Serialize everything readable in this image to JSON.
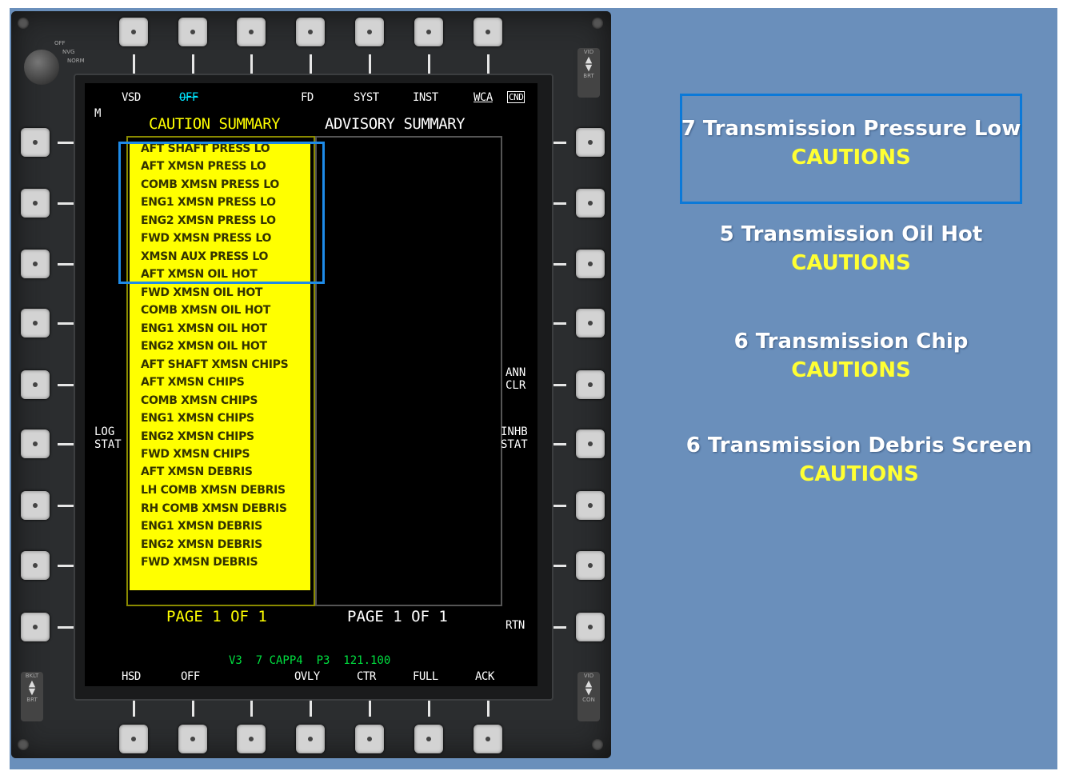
{
  "mfd": {
    "knob_labels": [
      "OFF",
      "NVG",
      "NORM"
    ],
    "rocker_top_right": [
      "VID",
      "BRT"
    ],
    "rocker_bottom_left": [
      "BKLT",
      "BRT"
    ],
    "rocker_bottom_right": [
      "VID",
      "CON"
    ],
    "top_labels": [
      "VSD",
      "OFF",
      "FD",
      "SYST",
      "INST",
      "WCA",
      "CND"
    ],
    "bottom_labels": [
      "HSD",
      "OFF",
      "OVLY",
      "CTR",
      "FULL",
      "ACK"
    ],
    "m_marker": "M",
    "left_label": [
      "LOG",
      "STAT"
    ],
    "right_labels": {
      "ann_clr": [
        "ANN",
        "CLR"
      ],
      "inhb_stat": [
        "INHB",
        "STAT"
      ],
      "rtn": "RTN"
    },
    "caution_title": "CAUTION SUMMARY",
    "advisory_title": "ADVISORY SUMMARY",
    "cautions": [
      "AFT SHAFT PRESS LO",
      "AFT XMSN PRESS LO",
      "COMB XMSN PRESS LO",
      "ENG1 XMSN PRESS LO",
      "ENG2 XMSN PRESS LO",
      "FWD XMSN PRESS LO",
      "XMSN AUX PRESS LO",
      "AFT XMSN OIL HOT",
      "FWD XMSN OIL HOT",
      "COMB XMSN OIL HOT",
      "ENG1 XMSN OIL HOT",
      "ENG2 XMSN OIL HOT",
      "AFT SHAFT XMSN CHIPS",
      "AFT XMSN CHIPS",
      "COMB XMSN CHIPS",
      "ENG1 XMSN CHIPS",
      "ENG2 XMSN CHIPS",
      "FWD XMSN CHIPS",
      "AFT XMSN DEBRIS",
      "LH COMB XMSN DEBRIS",
      "RH COMB XMSN DEBRIS",
      "ENG1 XMSN DEBRIS",
      "ENG2 XMSN DEBRIS",
      "FWD XMSN DEBRIS"
    ],
    "caution_page": "PAGE 1 OF 1",
    "advisory_page": "PAGE 1 OF 1",
    "status_line": "V3  7 CAPP4  P3  121.100"
  },
  "side_panel": [
    {
      "title": "7 Transmission Pressure Low",
      "subtitle": "CAUTIONS"
    },
    {
      "title": "5 Transmission Oil Hot",
      "subtitle": "CAUTIONS"
    },
    {
      "title": "6 Transmission Chip",
      "subtitle": "CAUTIONS"
    },
    {
      "title": "6 Transmission Debris Screen",
      "subtitle": "CAUTIONS"
    }
  ],
  "colors": {
    "caution_yellow": "#ffff00",
    "highlight_blue": "#1e8be8",
    "panel_blue": "#6a8fbb",
    "status_green": "#00e040"
  }
}
